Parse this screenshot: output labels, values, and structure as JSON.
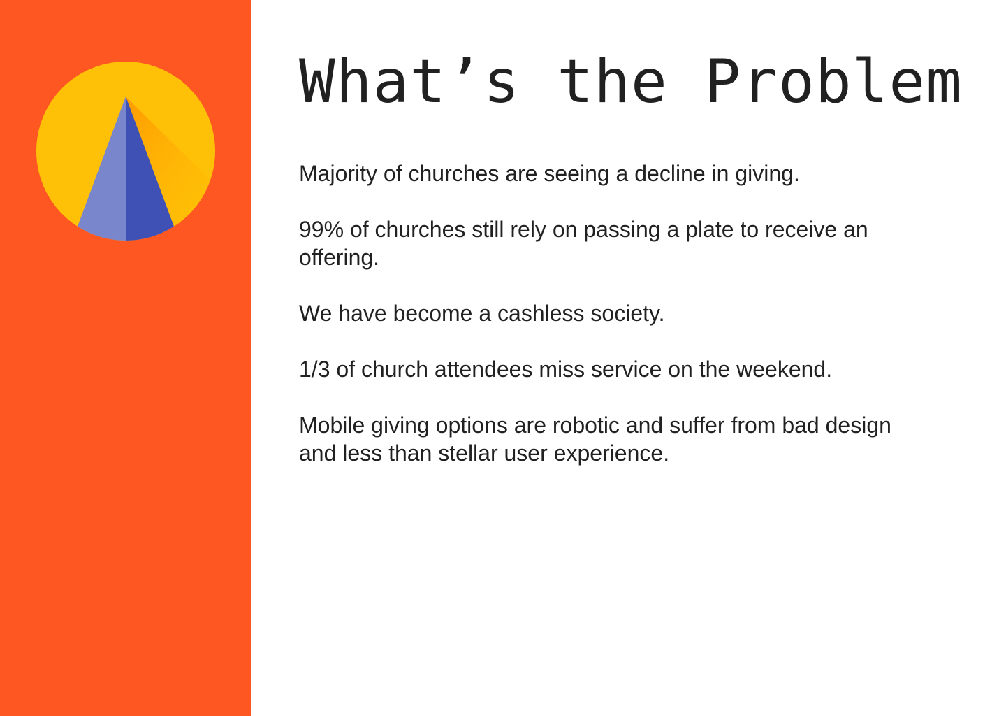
{
  "colors": {
    "sidebar": "#FF5722",
    "sun": "#FFC107",
    "triangle_light": "#7986CB",
    "triangle_dark": "#3F51B5",
    "shadow": "#FF9800",
    "text": "#212121"
  },
  "logo": {
    "icon": "sun-pyramid-logo-icon"
  },
  "slide": {
    "title": "What’s the Problem",
    "points": [
      "Majority of churches are seeing a decline in giving.",
      "99% of churches still rely on passing a plate to receive an offering.",
      "We have become a cashless society.",
      "1/3 of church attendees miss service on the weekend.",
      "Mobile giving options are robotic and suffer from bad design and less than stellar user experience."
    ]
  }
}
